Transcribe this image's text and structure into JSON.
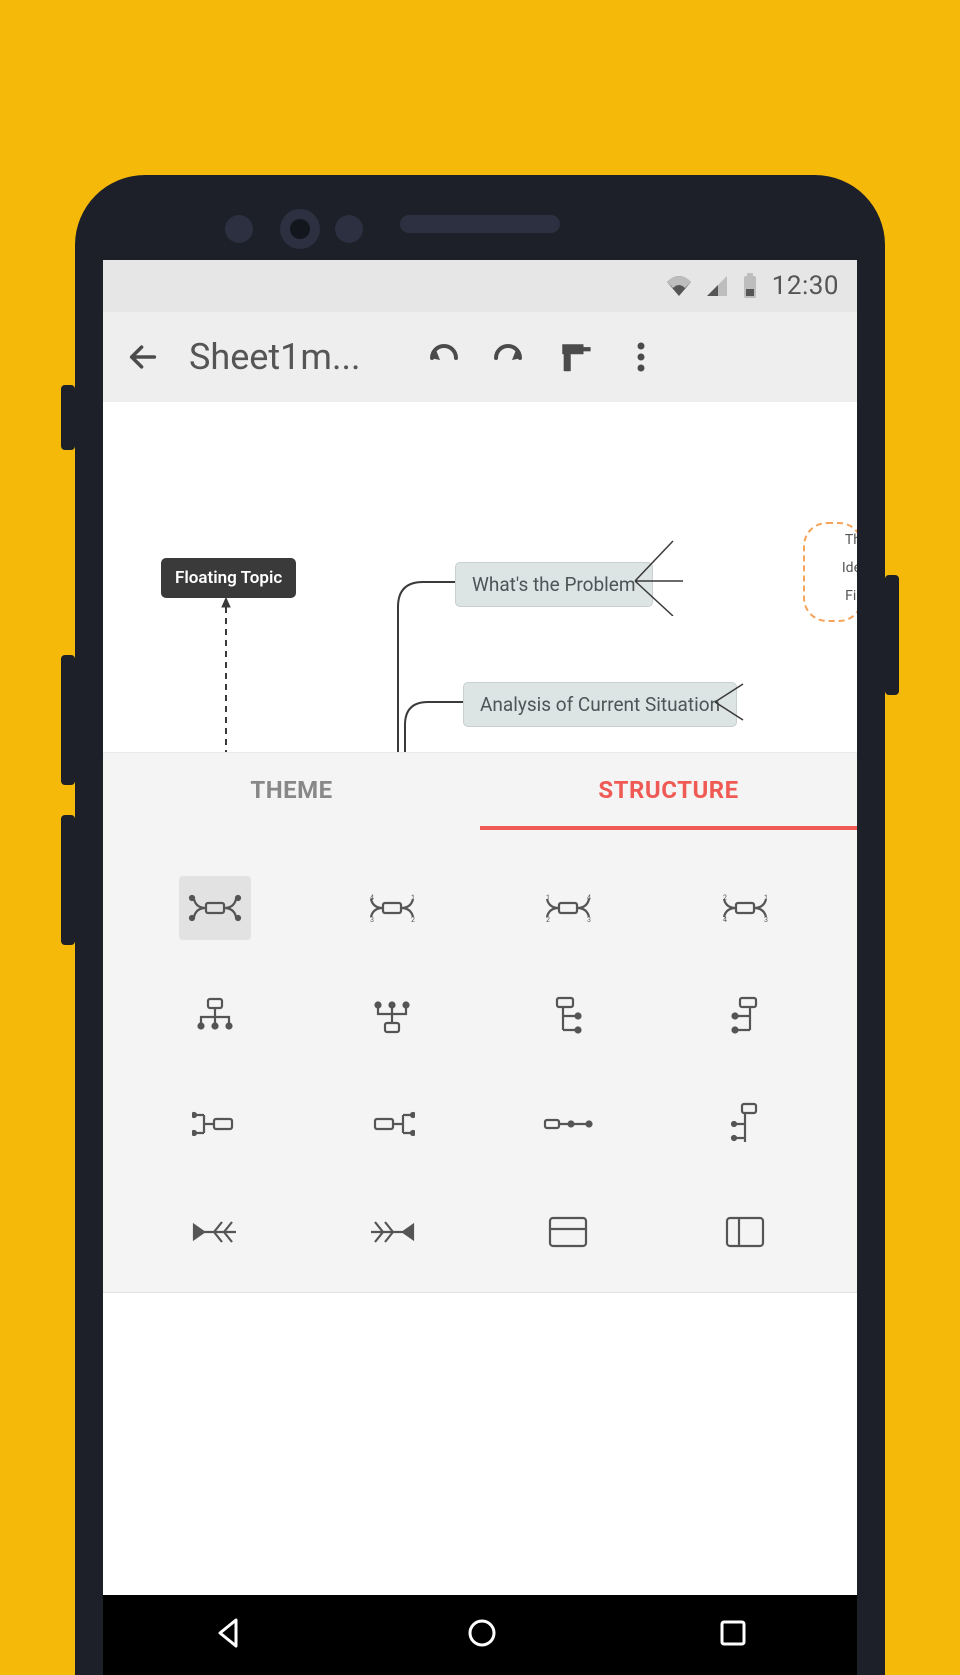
{
  "status": {
    "time": "12:30"
  },
  "toolbar": {
    "title": "Sheet1m..."
  },
  "canvas": {
    "floating_topic": "Floating Topic",
    "node1": "What's the Problem",
    "node2": "Analysis of Current Situation",
    "mini1": "Th",
    "mini2": "Ide",
    "mini3": "Fir"
  },
  "tabs": {
    "theme": "THEME",
    "structure": "STRUCTURE",
    "active": "structure"
  },
  "structure_options": [
    {
      "name": "map-balanced",
      "selected": true
    },
    {
      "name": "map-clockwise"
    },
    {
      "name": "map-anticlockwise"
    },
    {
      "name": "map-radial"
    },
    {
      "name": "org-down"
    },
    {
      "name": "org-up"
    },
    {
      "name": "tree-right"
    },
    {
      "name": "tree-left"
    },
    {
      "name": "logic-right"
    },
    {
      "name": "logic-left"
    },
    {
      "name": "timeline-horizontal"
    },
    {
      "name": "timeline-vertical"
    },
    {
      "name": "fishbone-left"
    },
    {
      "name": "fishbone-right"
    },
    {
      "name": "matrix"
    },
    {
      "name": "spreadsheet"
    }
  ]
}
